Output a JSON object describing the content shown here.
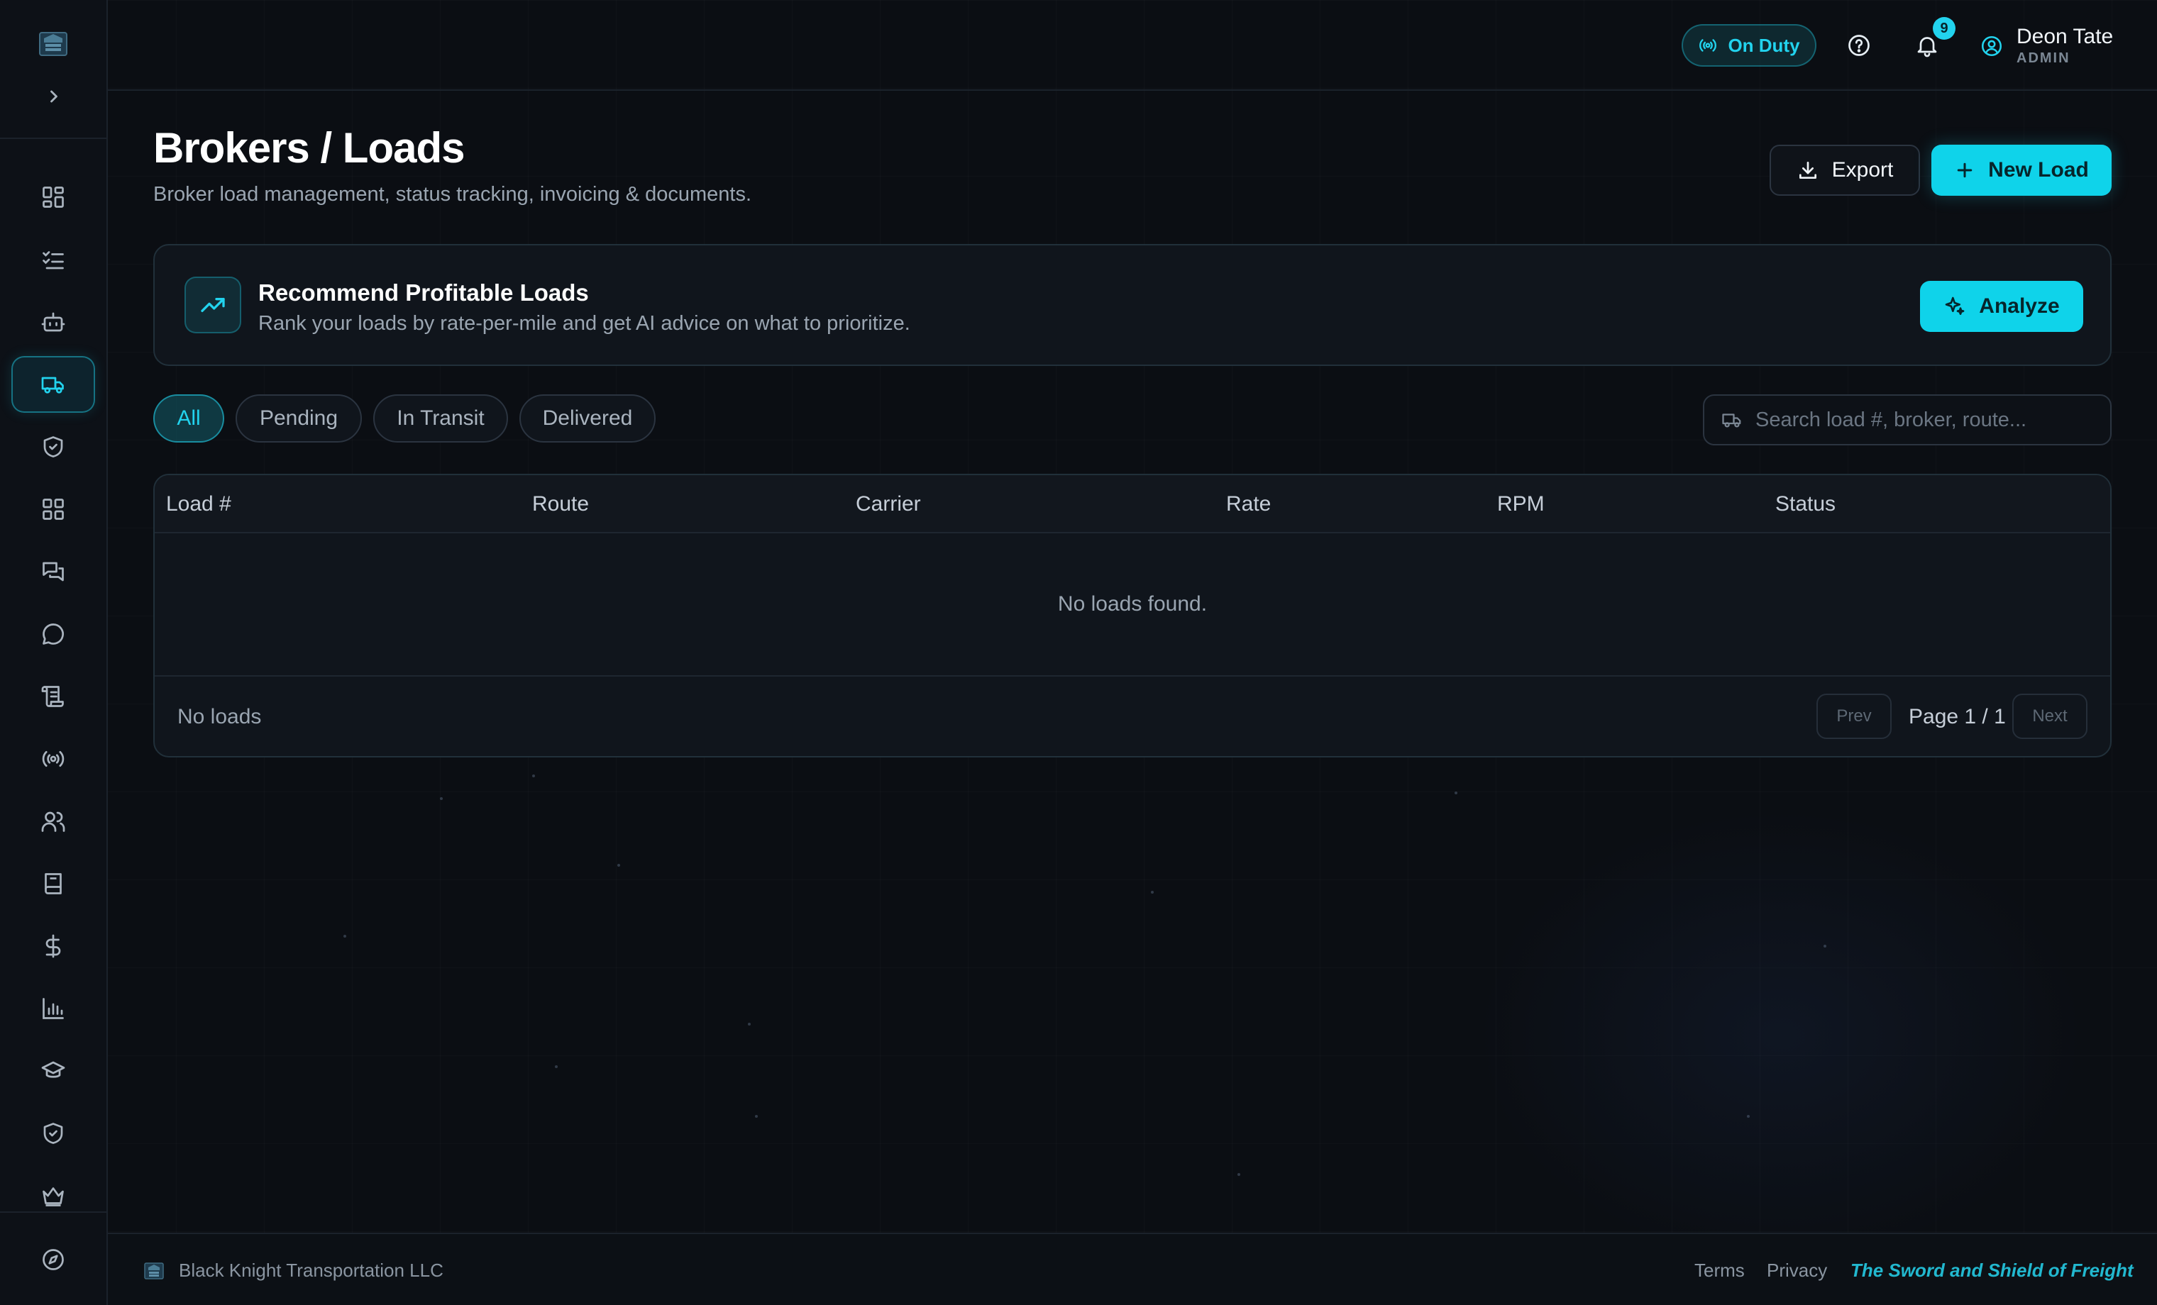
{
  "topbar": {
    "duty_label": "On Duty",
    "notification_count": "9",
    "user_name": "Deon Tate",
    "user_role": "ADMIN"
  },
  "sidebar": {
    "items": [
      {
        "icon": "dashboard-icon"
      },
      {
        "icon": "checklist-icon"
      },
      {
        "icon": "bot-icon"
      },
      {
        "icon": "truck-icon",
        "active": true
      },
      {
        "icon": "shield-check-icon"
      },
      {
        "icon": "apps-grid-icon"
      },
      {
        "icon": "messages-icon"
      },
      {
        "icon": "chat-bubble-icon"
      },
      {
        "icon": "scroll-icon"
      },
      {
        "icon": "broadcast-icon"
      },
      {
        "icon": "users-icon"
      },
      {
        "icon": "book-icon"
      },
      {
        "icon": "dollar-icon"
      },
      {
        "icon": "bar-chart-icon"
      },
      {
        "icon": "graduation-cap-icon"
      },
      {
        "icon": "shield-icon"
      },
      {
        "icon": "crown-icon"
      },
      {
        "icon": "compass-icon"
      }
    ]
  },
  "header": {
    "title": "Brokers / Loads",
    "subtitle": "Broker load management, status tracking, invoicing & documents.",
    "export_label": "Export",
    "new_load_label": "New Load"
  },
  "recommend": {
    "title": "Recommend Profitable Loads",
    "subtitle": "Rank your loads by rate-per-mile and get AI advice on what to prioritize.",
    "analyze_label": "Analyze"
  },
  "filters": {
    "tabs": [
      "All",
      "Pending",
      "In Transit",
      "Delivered"
    ],
    "active": "All",
    "search_placeholder": "Search load #, broker, route..."
  },
  "table": {
    "columns": [
      "Load #",
      "Route",
      "Carrier",
      "Rate",
      "RPM",
      "Status"
    ],
    "rows": [],
    "empty_message": "No loads found.",
    "count_label": "No loads",
    "prev_label": "Prev",
    "page_label": "Page 1 / 1",
    "next_label": "Next"
  },
  "footer": {
    "company": "Black Knight Transportation LLC",
    "terms": "Terms",
    "privacy": "Privacy",
    "tagline": "The Sword and Shield of Freight"
  },
  "colors": {
    "accent": "#0fd3ea",
    "background": "#0b0e13"
  }
}
